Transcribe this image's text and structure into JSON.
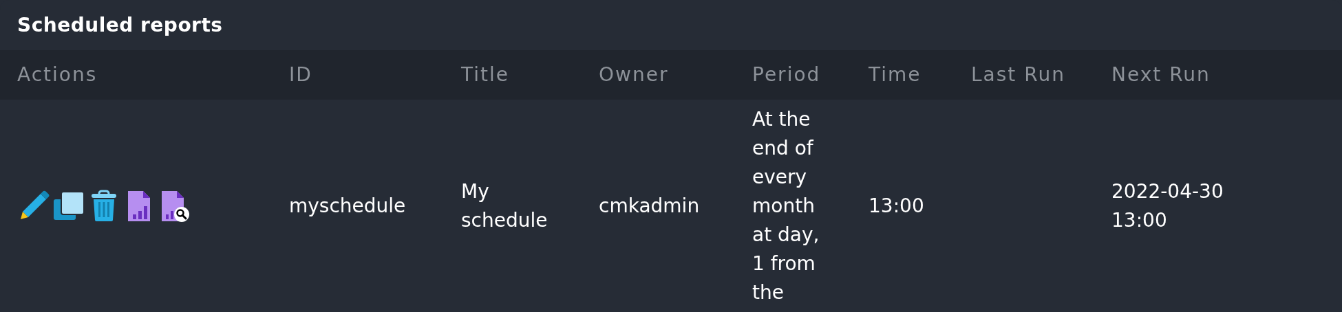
{
  "panel": {
    "title": "Scheduled reports"
  },
  "table": {
    "columns": [
      "Actions",
      "ID",
      "Title",
      "Owner",
      "Period",
      "Time",
      "Last Run",
      "Next Run"
    ],
    "rows": [
      {
        "id": "myschedule",
        "title": "My schedule",
        "owner": "cmkadmin",
        "period": "At the end of every month at day, 1 from the",
        "time": "13:00",
        "next_run": "2022-04-30 13:00"
      }
    ]
  }
}
